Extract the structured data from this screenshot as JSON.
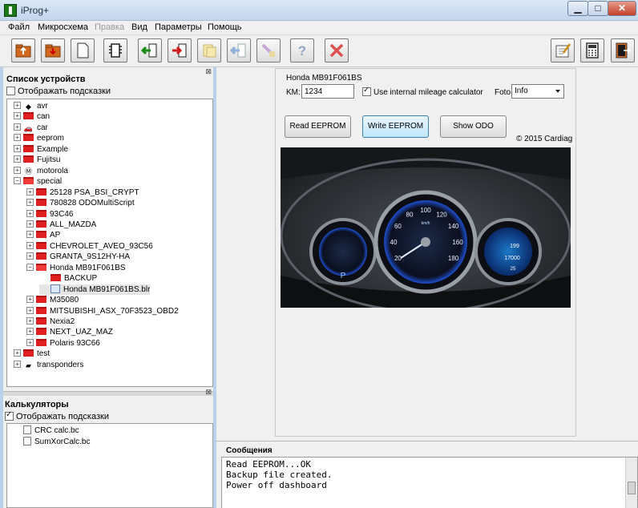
{
  "window": {
    "title": "iProg+"
  },
  "menu": [
    {
      "label": "Файл",
      "disabled": false
    },
    {
      "label": "Микросхема",
      "disabled": false
    },
    {
      "label": "Правка",
      "disabled": true
    },
    {
      "label": "Вид",
      "disabled": false
    },
    {
      "label": "Параметры",
      "disabled": false
    },
    {
      "label": "Помощь",
      "disabled": false
    }
  ],
  "toolbar": {
    "buttons": [
      "open-folder-icon",
      "save-folder-icon",
      "new-page-icon",
      "chip-icon",
      "read-icon",
      "write-icon",
      "copy-disabled-icon",
      "verify-disabled-icon",
      "erase-disabled-icon",
      "help-icon",
      "stop-icon",
      "notepad-icon",
      "calculator-icon",
      "exit-icon"
    ]
  },
  "devices": {
    "title": "Список устройств",
    "hint_label": "Отображать подсказки",
    "hint_checked": false,
    "tree": [
      {
        "label": "avr",
        "icon": "chip-icon",
        "expander": "+"
      },
      {
        "label": "can",
        "icon": "folder-icon",
        "expander": "+"
      },
      {
        "label": "car",
        "icon": "car-icon",
        "expander": "+"
      },
      {
        "label": "eeprom",
        "icon": "folder-icon",
        "expander": "+"
      },
      {
        "label": "Example",
        "icon": "folder-icon",
        "expander": "+"
      },
      {
        "label": "Fujitsu",
        "icon": "folder-icon",
        "expander": "+"
      },
      {
        "label": "motorola",
        "icon": "motorola-icon",
        "expander": "+"
      },
      {
        "label": "special",
        "icon": "folder-open-icon",
        "expander": "−"
      },
      {
        "label": "25128 PSA_BSI_CRYPT",
        "icon": "folder-icon",
        "expander": "+"
      },
      {
        "label": "780828 ODOMultiScript",
        "icon": "folder-icon",
        "expander": "+"
      },
      {
        "label": "93C46",
        "icon": "folder-icon",
        "expander": "+"
      },
      {
        "label": "ALL_MAZDA",
        "icon": "folder-icon",
        "expander": "+"
      },
      {
        "label": "AP",
        "icon": "folder-icon",
        "expander": "+"
      },
      {
        "label": "CHEVROLET_AVEO_93C56",
        "icon": "folder-icon",
        "expander": "+"
      },
      {
        "label": "GRANTA_9S12HY-HA",
        "icon": "folder-icon",
        "expander": "+"
      },
      {
        "label": "Honda MB91F061BS",
        "icon": "folder-open-icon",
        "expander": "−"
      },
      {
        "label": "BACKUP",
        "icon": "folder-icon",
        "expander": ""
      },
      {
        "label": "Honda MB91F061BS.blr",
        "icon": "blr-file-icon",
        "expander": ""
      },
      {
        "label": "M35080",
        "icon": "folder-icon",
        "expander": "+"
      },
      {
        "label": "MITSUBISHI_ASX_70F3523_OBD2",
        "icon": "folder-icon",
        "expander": "+"
      },
      {
        "label": "Nexia2",
        "icon": "folder-icon",
        "expander": "+"
      },
      {
        "label": "NEXT_UAZ_MAZ",
        "icon": "folder-icon",
        "expander": "+"
      },
      {
        "label": "Polaris 93C66",
        "icon": "folder-icon",
        "expander": "+"
      },
      {
        "label": "test",
        "icon": "folder-icon",
        "expander": "+"
      },
      {
        "label": "transponders",
        "icon": "transponder-icon",
        "expander": "+"
      }
    ]
  },
  "calculators": {
    "title": "Калькуляторы",
    "hint_label": "Отображать подсказки",
    "hint_checked": true,
    "items": [
      "CRC calc.bc",
      "SumXorCalc.bc"
    ]
  },
  "plugin": {
    "title": "Honda MB91F061BS",
    "km_label": "KM:",
    "km_value": "1234",
    "mileage_label": "Use internal mileage calculator",
    "mileage_checked": true,
    "foto_label": "Foto",
    "foto_value": "Info",
    "read_button": "Read EEPROM",
    "write_button": "Write EEPROM",
    "odo_button": "Show ODO",
    "copyright": "© 2015 Cardiag"
  },
  "dashboard": {
    "speed_ticks": [
      "20",
      "40",
      "60",
      "80",
      "100",
      "120",
      "140",
      "160",
      "180"
    ],
    "speed_unit": "km/h",
    "fuel_gear": "P",
    "readouts": [
      "199",
      "17000",
      "25"
    ]
  },
  "messages": {
    "title": "Сообщения",
    "lines": [
      "Read EEPROM...OK",
      "Backup file created.",
      "Power off dashboard"
    ]
  },
  "colors": {
    "folder": "#e02020",
    "accent_button": "#bee6fd",
    "title_bar": "#c3d6ec"
  }
}
